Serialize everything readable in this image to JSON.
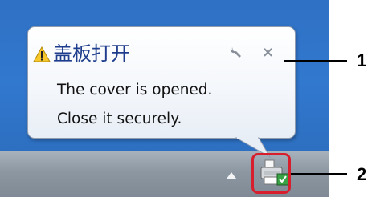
{
  "notification": {
    "title": "盖板打开",
    "message_line1": "The cover is opened.",
    "message_line2": "Close it securely.",
    "icon": "warning-icon",
    "options_icon": "wrench-icon",
    "close_icon": "close-icon",
    "close_glyph": "×"
  },
  "tray": {
    "show_hidden_icon": "up-arrow-icon",
    "printer_icon": "printer-status-icon"
  },
  "callouts": [
    {
      "number": "1"
    },
    {
      "number": "2"
    }
  ],
  "colors": {
    "desktop": "#2f71c4",
    "highlight": "#d81e2c",
    "title": "#1e3d8c"
  }
}
